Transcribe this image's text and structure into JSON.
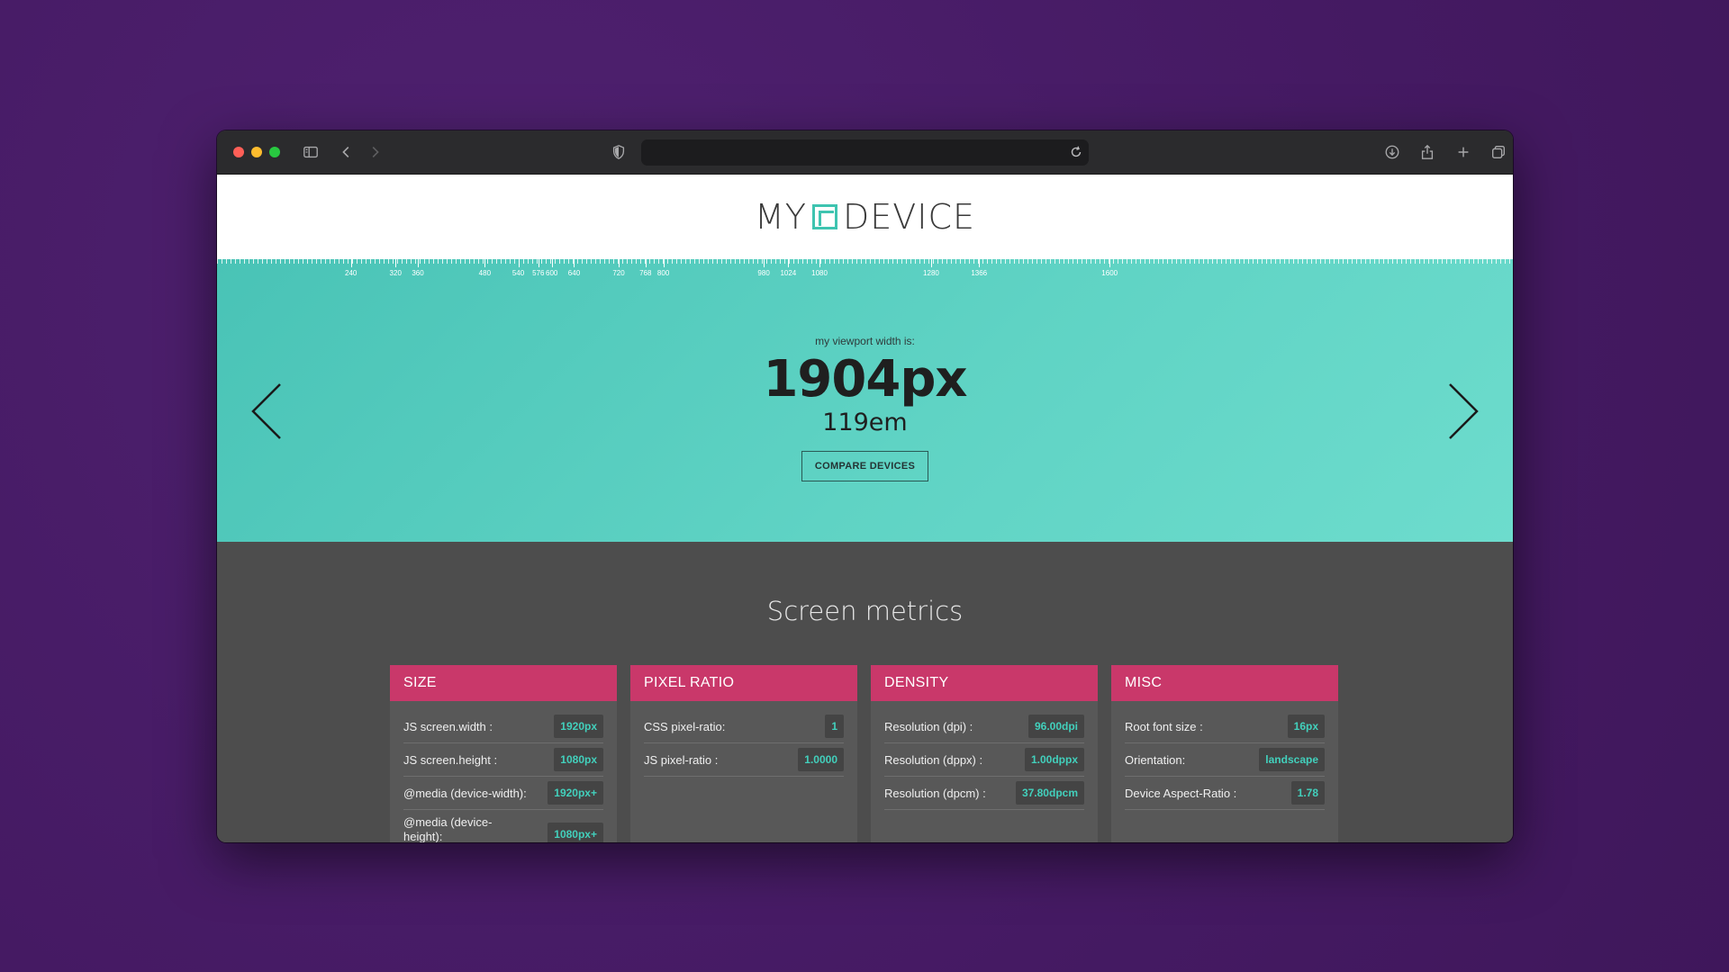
{
  "browser": {
    "url": "",
    "icons": [
      "sidebar-icon",
      "back-icon",
      "forward-icon",
      "shield-icon",
      "reload-icon",
      "download-icon",
      "share-icon",
      "new-tab-icon",
      "tabs-overview-icon"
    ]
  },
  "site": {
    "logo_left": "MY",
    "logo_right": "DEVICE"
  },
  "ruler": {
    "labels": [
      "240",
      "320",
      "360",
      "480",
      "540",
      "576",
      "600",
      "640",
      "720",
      "768",
      "800",
      "980",
      "1024",
      "1080",
      "1280",
      "1366",
      "1600"
    ]
  },
  "hero": {
    "viewport_label": "my viewport width is:",
    "viewport_px": "1904px",
    "viewport_em": "119em",
    "compare_button": "COMPARE DEVICES"
  },
  "metrics": {
    "title": "Screen metrics",
    "cards": [
      {
        "title": "SIZE",
        "rows": [
          {
            "key": "JS screen.width :",
            "value": "1920px"
          },
          {
            "key": "JS screen.height :",
            "value": "1080px"
          },
          {
            "key": "@media (device-width):",
            "value": "1920px+"
          },
          {
            "key": "@media (device-height):",
            "value": "1080px+"
          }
        ]
      },
      {
        "title": "PIXEL RATIO",
        "rows": [
          {
            "key": "CSS pixel-ratio:",
            "value": "1"
          },
          {
            "key": "JS pixel-ratio :",
            "value": "1.0000"
          }
        ]
      },
      {
        "title": "DENSITY",
        "rows": [
          {
            "key": "Resolution (dpi) :",
            "value": "96.00dpi"
          },
          {
            "key": "Resolution (dppx) :",
            "value": "1.00dppx"
          },
          {
            "key": "Resolution (dpcm) :",
            "value": "37.80dpcm"
          }
        ]
      },
      {
        "title": "MISC",
        "rows": [
          {
            "key": "Root font size :",
            "value": "16px"
          },
          {
            "key": "Orientation:",
            "value": "landscape"
          },
          {
            "key": "Device Aspect-Ratio :",
            "value": "1.78"
          }
        ]
      }
    ]
  },
  "colors": {
    "background": "#4a1e6b",
    "hero": "#5fd3c4",
    "card_header": "#c9386a",
    "value_accent": "#42d0bc",
    "metrics_bg": "#4d4d4d"
  }
}
